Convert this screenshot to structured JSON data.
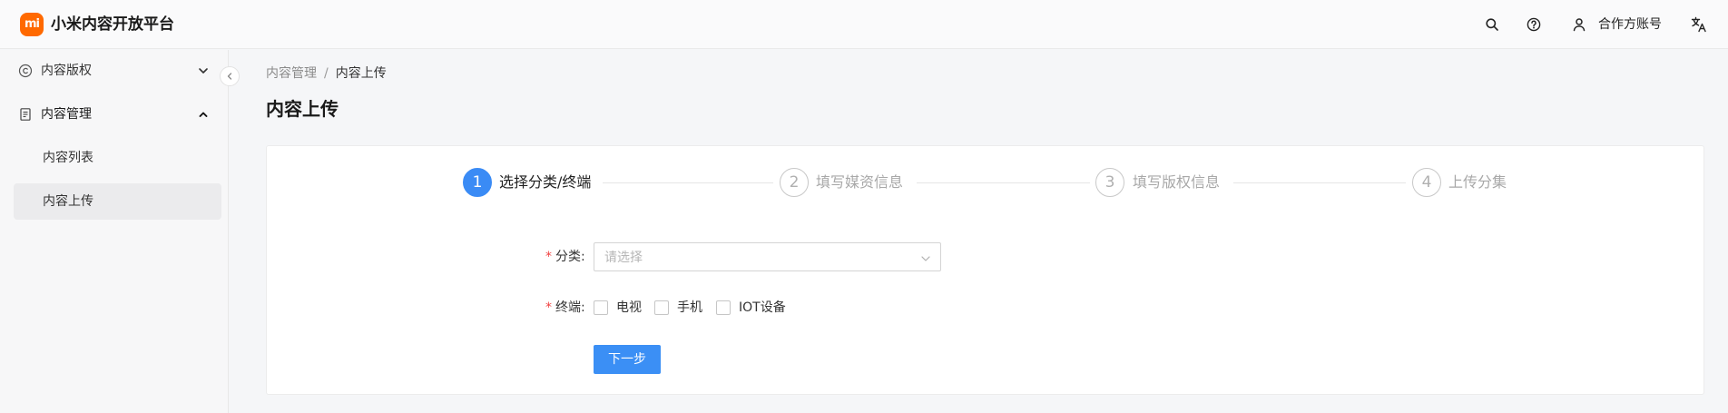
{
  "header": {
    "logo_text": "mi",
    "app_title": "小米内容开放平台",
    "account_label": "合作方账号",
    "icons": [
      "search-icon",
      "help-icon",
      "user-icon",
      "translate-icon"
    ]
  },
  "sidebar": {
    "groups": [
      {
        "label": "内容版权",
        "icon": "copyright-icon",
        "expanded": false
      },
      {
        "label": "内容管理",
        "icon": "document-icon",
        "expanded": true,
        "children": [
          {
            "label": "内容列表",
            "active": false
          },
          {
            "label": "内容上传",
            "active": true
          }
        ]
      }
    ]
  },
  "breadcrumb": {
    "parent": "内容管理",
    "separator": "/",
    "current": "内容上传"
  },
  "page_title": "内容上传",
  "steps": [
    {
      "number": "1",
      "label": "选择分类/终端",
      "active": true
    },
    {
      "number": "2",
      "label": "填写媒资信息",
      "active": false
    },
    {
      "number": "3",
      "label": "填写版权信息",
      "active": false
    },
    {
      "number": "4",
      "label": "上传分集",
      "active": false
    }
  ],
  "form": {
    "category": {
      "label": "分类:",
      "required_mark": "*",
      "placeholder": "请选择"
    },
    "terminal": {
      "label": "终端:",
      "required_mark": "*",
      "options": [
        {
          "label": "电视",
          "checked": false
        },
        {
          "label": "手机",
          "checked": false
        },
        {
          "label": "IOT设备",
          "checked": false
        }
      ]
    },
    "next_button": "下一步"
  },
  "colors": {
    "brand": "#ff6900",
    "primary": "#3b8ff5",
    "required": "#f04242"
  }
}
